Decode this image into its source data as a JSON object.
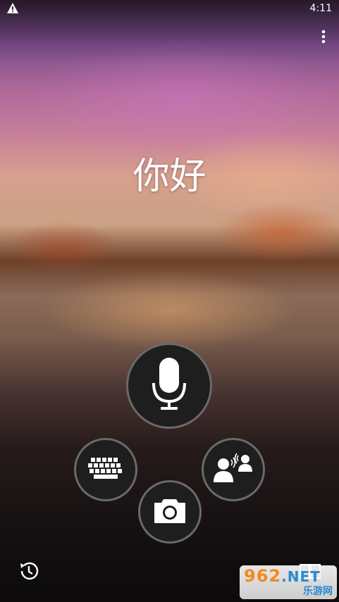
{
  "status_bar": {
    "warning_icon": "warning-triangle-icon",
    "time": "4:11"
  },
  "toolbar": {
    "menu_icon": "more-vert-icon"
  },
  "main": {
    "phrase": "你好"
  },
  "actions": {
    "microphone": {
      "icon": "microphone-icon"
    },
    "keyboard": {
      "icon": "keyboard-icon"
    },
    "conversation": {
      "icon": "conversation-icon"
    },
    "camera": {
      "icon": "camera-icon"
    }
  },
  "bottom_bar": {
    "history_icon": "history-icon",
    "phrasebook_icon": "phrasebook-icon"
  },
  "watermark": {
    "brand_number": "962",
    "brand_domain": ".NET",
    "brand_text": "乐游网"
  },
  "colors": {
    "button_fill": "#1e1e1e",
    "button_ring": "#aaaaaa",
    "icon_white": "#ffffff",
    "watermark_orange": "#f08a1c",
    "watermark_blue": "#2b8ad0"
  }
}
